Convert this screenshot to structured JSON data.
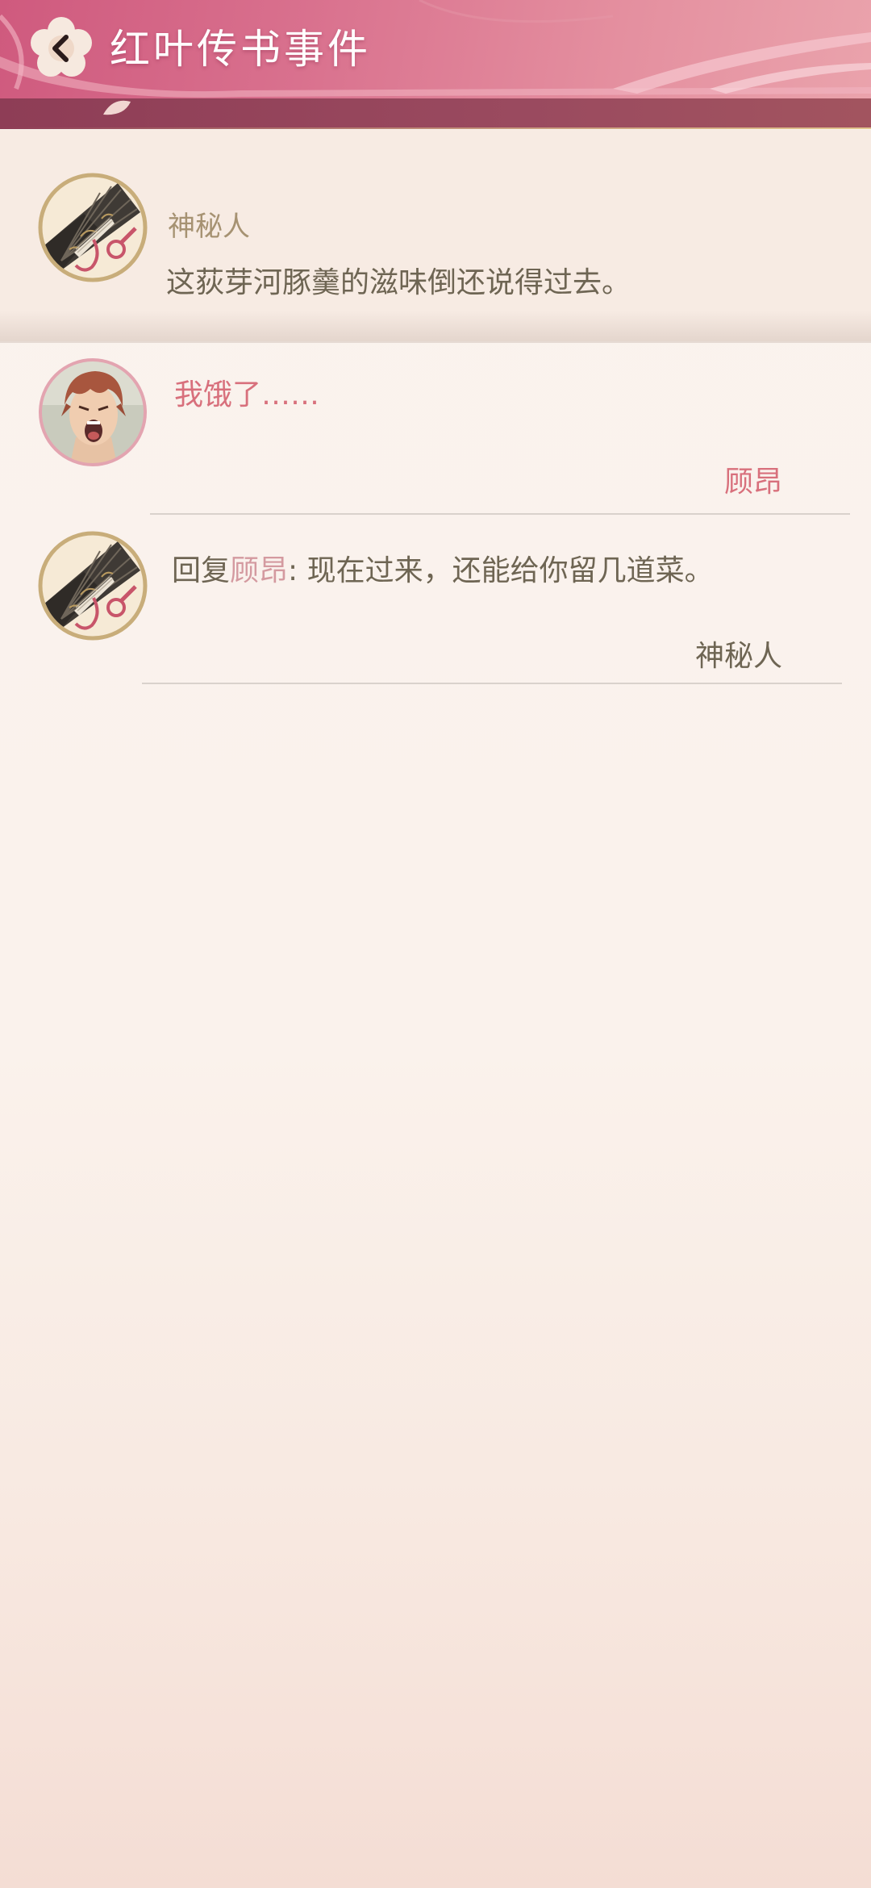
{
  "header": {
    "title": "红叶传书事件"
  },
  "post": {
    "author": "神秘人",
    "content": "这荻芽河豚羹的滋味倒还说得过去。"
  },
  "comments": [
    {
      "text": "我饿了……",
      "signature": "顾昂"
    },
    {
      "prefix": "回复",
      "reply_to": "顾昂",
      "separator": ": ",
      "text": "现在过来，还能给你留几道菜。",
      "signature": "神秘人"
    }
  ],
  "colors": {
    "header_pink": "#d9718e",
    "author_gold": "#a69272",
    "body_text": "#6e6553",
    "pink_text": "#d8707c",
    "reply_pink": "#d49aa0"
  }
}
